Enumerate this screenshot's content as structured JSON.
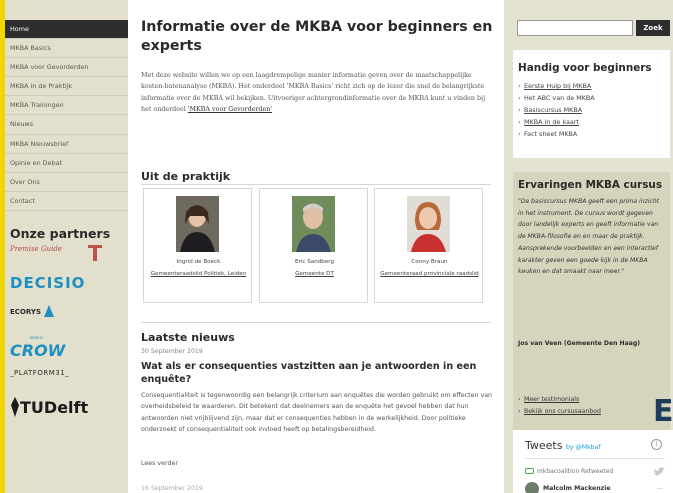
{
  "sidebar": {
    "nav": [
      {
        "label": "Home",
        "active": true
      },
      {
        "label": "MKBA Basics"
      },
      {
        "label": "MKBA voor Gevorderden"
      },
      {
        "label": "MKBA in de Praktijk"
      },
      {
        "label": "MKBA Trainingen"
      },
      {
        "label": "Nieuws"
      },
      {
        "label": "MKBA Nieuwsbrief"
      },
      {
        "label": "Opinie en Debat"
      },
      {
        "label": "Over Ons"
      },
      {
        "label": "Contact"
      }
    ],
    "partners_heading": "Onze partners",
    "logos": {
      "premise": "Premise Guide",
      "decisio": "DECISIO",
      "econ": "ECORYS",
      "crow_tag": "kennis",
      "crow": "CROW",
      "platform": "_PLATFORM31_",
      "tudelft": "TUDelft"
    }
  },
  "main": {
    "title": "Informatie over de MKBA voor beginners en experts",
    "intro_text": "Met deze website willen we op een laagdrempelige manier informatie geven over de maatschappelijke kosten-batenanalyse (MKBA). Het onderdeel 'MKBA Basics' richt zich op de lezer die snel de belangrijkste informatie over de MKBA wil bekijken. Uitvoeriger achtergrondinformatie over de MKBA kunt u vinden bij het onderdeel",
    "intro_link": "'MKBA voor Gevorderden'",
    "praktijk_heading": "Uit de praktijk",
    "cards": [
      {
        "name": "Ingrid de Boeck",
        "link": "Gemeenteraadslid Politiek, Leiden"
      },
      {
        "name": "Eric Sandberg",
        "link": "Gemeente DT"
      },
      {
        "name": "Conny Braun",
        "link": "Gemeenteraad provinciale raadslid"
      }
    ],
    "news_heading": "Laatste nieuws",
    "news_date": "30 September 2019",
    "news_title": "Wat als er consequenties vastzitten aan je antwoorden in een enquête?",
    "news_body": "Consequentialiteit is tegenwoordig een belangrijk criterium aan enquêtes die worden gebruikt om effecten van overheidsbeleid te waarderen. Dit betekent dat deelnemers aan de enquête het gevoel hebben dat hun antwoorden niet vrijblijvend zijn, maar dat er consequenties hebben in de werkelijkheid. Door politieke onderzoekt of consequentialiteit ook invloed heeft op betalingsbereidheid.",
    "news_more": "Lees verder",
    "next_date": "16 September 2019"
  },
  "right": {
    "search": {
      "placeholder": "",
      "button": "Zoek"
    },
    "beginners_heading": "Handig voor beginners",
    "beginners_links": [
      {
        "label": "Eerste Hulp bij MKBA",
        "underline": true
      },
      {
        "label": "Het ABC van de MKBA",
        "underline": false
      },
      {
        "label": "Basiscursus MKBA",
        "underline": true
      },
      {
        "label": "MKBA in de kaart",
        "underline": true
      },
      {
        "label": "Fact sheet MKBA",
        "underline": false
      }
    ],
    "experiences_heading": "Ervaringen MKBA cursus",
    "experiences_quote": "\"De basiscursus MKBA geeft een prima inzicht in het instrument. De cursus wordt gegeven door landelijk experts en geeft informatie van de MKBA-filosofie en en maar de praktijk. Aansprekende voorbeelden en een interactief karakter geven een goede kijk in de MKBA keuken en dat smaakt naar meer.\"",
    "experiences_author": "Jos van Veen (Gemeente Den Haag)",
    "experiences_links": [
      "Meer testimonials",
      "Bekijk ons cursusaanbod"
    ],
    "big_letter": "E",
    "tweets": {
      "header": "Tweets",
      "by": "by",
      "handle": "@Mkbaf",
      "retweet_label": "mkbacoalition Retweeted",
      "author": "Malcolm Mackenzie"
    }
  },
  "colors": {
    "accent_yellow": "#f2d600",
    "sidebar_bg": "#e2e0cc",
    "dark_nav": "#2e2e2e",
    "decisio_blue": "#1e8fc0",
    "tudelft_dark": "#1a1a1a",
    "experience_box": "#d7d4bd"
  },
  "icons": [
    "premise-mark-icon",
    "econ-mark-icon",
    "tudelft-mark-icon",
    "info-icon",
    "retweet-icon",
    "bird-icon",
    "more-icon"
  ]
}
